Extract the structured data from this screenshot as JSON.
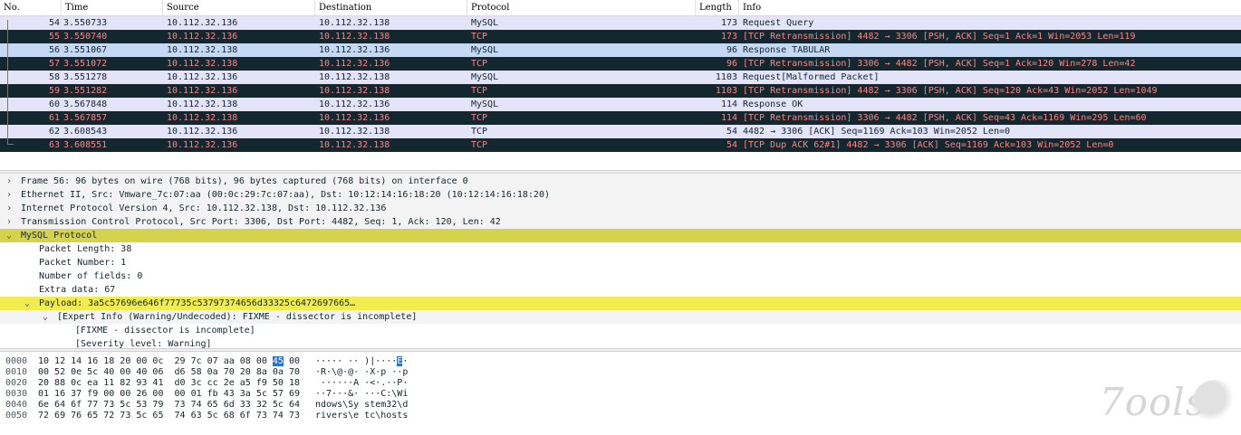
{
  "columns": [
    "No.",
    "Time",
    "Source",
    "Destination",
    "Protocol",
    "Length",
    "Info"
  ],
  "packets": [
    {
      "no": "54",
      "time": "3.550733",
      "src": "10.112.32.136",
      "dst": "10.112.32.138",
      "proto": "MySQL",
      "len": "173",
      "info": "Request Query",
      "style": "mysql"
    },
    {
      "no": "55",
      "time": "3.550740",
      "src": "10.112.32.136",
      "dst": "10.112.32.138",
      "proto": "TCP",
      "len": "173",
      "info": "[TCP Retransmission] 4482 → 3306 [PSH, ACK] Seq=1 Ack=1 Win=2053 Len=119",
      "style": "bad"
    },
    {
      "no": "56",
      "time": "3.551067",
      "src": "10.112.32.138",
      "dst": "10.112.32.136",
      "proto": "MySQL",
      "len": "96",
      "info": "Response TABULAR",
      "style": "selected"
    },
    {
      "no": "57",
      "time": "3.551072",
      "src": "10.112.32.138",
      "dst": "10.112.32.136",
      "proto": "TCP",
      "len": "96",
      "info": "[TCP Retransmission] 3306 → 4482 [PSH, ACK] Seq=1 Ack=120 Win=278 Len=42",
      "style": "bad"
    },
    {
      "no": "58",
      "time": "3.551278",
      "src": "10.112.32.136",
      "dst": "10.112.32.138",
      "proto": "MySQL",
      "len": "1103",
      "info": "Request[Malformed Packet]",
      "style": "mysql"
    },
    {
      "no": "59",
      "time": "3.551282",
      "src": "10.112.32.136",
      "dst": "10.112.32.138",
      "proto": "TCP",
      "len": "1103",
      "info": "[TCP Retransmission] 4482 → 3306 [PSH, ACK] Seq=120 Ack=43 Win=2052 Len=1049",
      "style": "bad"
    },
    {
      "no": "60",
      "time": "3.567848",
      "src": "10.112.32.138",
      "dst": "10.112.32.136",
      "proto": "MySQL",
      "len": "114",
      "info": "Response OK",
      "style": "mysql"
    },
    {
      "no": "61",
      "time": "3.567857",
      "src": "10.112.32.138",
      "dst": "10.112.32.136",
      "proto": "TCP",
      "len": "114",
      "info": "[TCP Retransmission] 3306 → 4482 [PSH, ACK] Seq=43 Ack=1169 Win=295 Len=60",
      "style": "bad"
    },
    {
      "no": "62",
      "time": "3.608543",
      "src": "10.112.32.136",
      "dst": "10.112.32.138",
      "proto": "TCP",
      "len": "54",
      "info": "4482 → 3306 [ACK] Seq=1169 Ack=103 Win=2052 Len=0",
      "style": "mysql"
    },
    {
      "no": "63",
      "time": "3.608551",
      "src": "10.112.32.136",
      "dst": "10.112.32.138",
      "proto": "TCP",
      "len": "54",
      "info": "[TCP Dup ACK 62#1] 4482 → 3306 [ACK] Seq=1169 Ack=103 Win=2052 Len=0",
      "style": "bad"
    }
  ],
  "details": [
    {
      "text": "Frame 56: 96 bytes on wire (768 bits), 96 bytes captured (768 bits) on interface 0",
      "indent": 0,
      "arrow": "collapsed",
      "style": "grey"
    },
    {
      "text": "Ethernet II, Src: Vmware_7c:07:aa (00:0c:29:7c:07:aa), Dst: 10:12:14:16:18:20 (10:12:14:16:18:20)",
      "indent": 0,
      "arrow": "collapsed",
      "style": "grey"
    },
    {
      "text": "Internet Protocol Version 4, Src: 10.112.32.138, Dst: 10.112.32.136",
      "indent": 0,
      "arrow": "collapsed",
      "style": "grey"
    },
    {
      "text": "Transmission Control Protocol, Src Port: 3306, Dst Port: 4482, Seq: 1, Ack: 120, Len: 42",
      "indent": 0,
      "arrow": "collapsed",
      "style": "grey"
    },
    {
      "text": "MySQL Protocol",
      "indent": 0,
      "arrow": "expanded",
      "style": "hl-dark"
    },
    {
      "text": "Packet Length: 38",
      "indent": 1,
      "arrow": "none",
      "style": ""
    },
    {
      "text": "Packet Number: 1",
      "indent": 1,
      "arrow": "none",
      "style": ""
    },
    {
      "text": "Number of fields: 0",
      "indent": 1,
      "arrow": "none",
      "style": ""
    },
    {
      "text": "Extra data: 67",
      "indent": 1,
      "arrow": "none",
      "style": ""
    },
    {
      "text": "Payload: 3a5c57696e646f77735c53797374656d33325c6472697665…",
      "indent": 1,
      "arrow": "expanded",
      "style": "hl-light"
    },
    {
      "text": "[Expert Info (Warning/Undecoded): FIXME - dissector is incomplete]",
      "indent": 2,
      "arrow": "expanded",
      "style": "grey"
    },
    {
      "text": "[FIXME - dissector is incomplete]",
      "indent": 3,
      "arrow": "none",
      "style": ""
    },
    {
      "text": "[Severity level: Warning]",
      "indent": 3,
      "arrow": "none",
      "style": ""
    }
  ],
  "bytes": [
    {
      "offset": "0000",
      "hex_before": "10 12 14 16 18 20 00 0c  29 7c 07 aa 08 00 ",
      "hex_hl": "45",
      "hex_after": " 00",
      "ascii_before": "····· ·· )|····",
      "ascii_hl": "E",
      "ascii_after": "·"
    },
    {
      "offset": "0010",
      "hex_before": "00 52 0e 5c 40 00 40 06  d6 58 0a 70 20 8a 0a 70",
      "hex_hl": "",
      "hex_after": "",
      "ascii_before": "·R·\\@·@· ·X·p ··p",
      "ascii_hl": "",
      "ascii_after": ""
    },
    {
      "offset": "0020",
      "hex_before": "20 88 0c ea 11 82 93 41  d0 3c cc 2e a5 f9 50 18",
      "hex_hl": "",
      "hex_after": "",
      "ascii_before": " ······A ·<·.··P·",
      "ascii_hl": "",
      "ascii_after": ""
    },
    {
      "offset": "0030",
      "hex_before": "01 16 37 f9 00 00 26 00  00 01 fb 43 3a 5c 57 69",
      "hex_hl": "",
      "hex_after": "",
      "ascii_before": "··7···&· ···C:\\Wi",
      "ascii_hl": "",
      "ascii_after": ""
    },
    {
      "offset": "0040",
      "hex_before": "6e 64 6f 77 73 5c 53 79  73 74 65 6d 33 32 5c 64",
      "hex_hl": "",
      "hex_after": "",
      "ascii_before": "ndows\\Sy stem32\\d",
      "ascii_hl": "",
      "ascii_after": ""
    },
    {
      "offset": "0050",
      "hex_before": "72 69 76 65 72 73 5c 65  74 63 5c 68 6f 73 74 73",
      "hex_hl": "",
      "hex_after": "",
      "ascii_before": "rivers\\e tc\\hosts",
      "ascii_hl": "",
      "ascii_after": ""
    }
  ],
  "watermark": "7ools"
}
